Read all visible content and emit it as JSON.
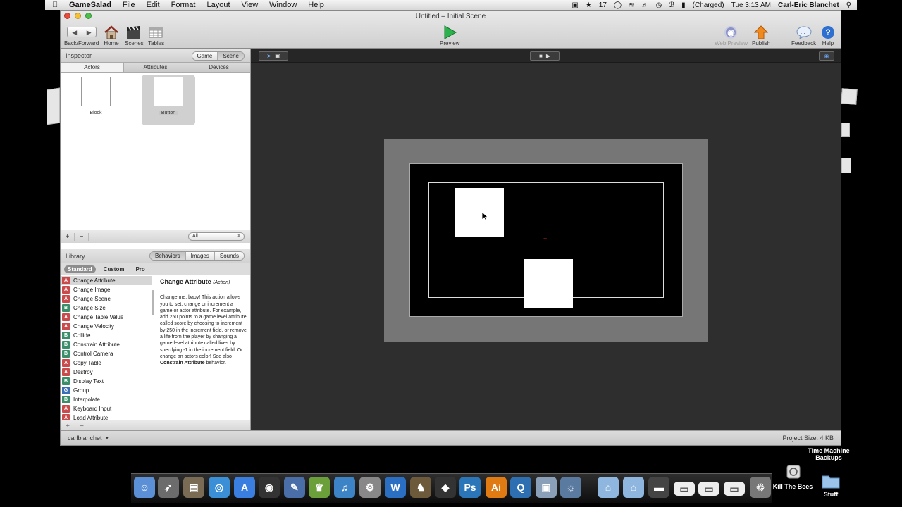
{
  "menubar": {
    "items": [
      "GameSalad",
      "File",
      "Edit",
      "Format",
      "Layout",
      "View",
      "Window",
      "Help"
    ],
    "status_badge": "17",
    "battery": "(Charged)",
    "clock": "Tue 3:13 AM",
    "user": "Carl-Eric Blanchet"
  },
  "window": {
    "title": "Untitled – Initial Scene",
    "toolbar": {
      "backforward": "Back/Forward",
      "home": "Home",
      "scenes": "Scenes",
      "tables": "Tables",
      "preview": "Preview",
      "web_preview": "Web Preview",
      "publish": "Publish",
      "feedback": "Feedback",
      "help": "Help"
    }
  },
  "inspector": {
    "title": "Inspector",
    "seg_game": "Game",
    "seg_scene": "Scene",
    "tabs": [
      "Actors",
      "Attributes",
      "Devices"
    ],
    "actors": [
      {
        "name": "Block"
      },
      {
        "name": "Button"
      }
    ],
    "plus": "+",
    "minus": "−",
    "filter": "All"
  },
  "library": {
    "title": "Library",
    "tabs": [
      "Behaviors",
      "Images",
      "Sounds"
    ],
    "subtabs": [
      "Standard",
      "Custom",
      "Pro"
    ],
    "behaviors": [
      {
        "badge": "A",
        "label": "Change Attribute"
      },
      {
        "badge": "A",
        "label": "Change Image"
      },
      {
        "badge": "A",
        "label": "Change Scene"
      },
      {
        "badge": "B",
        "label": "Change Size"
      },
      {
        "badge": "A",
        "label": "Change Table Value"
      },
      {
        "badge": "A",
        "label": "Change Velocity"
      },
      {
        "badge": "B",
        "label": "Collide"
      },
      {
        "badge": "B",
        "label": "Constrain Attribute"
      },
      {
        "badge": "B",
        "label": "Control Camera"
      },
      {
        "badge": "A",
        "label": "Copy Table"
      },
      {
        "badge": "A",
        "label": "Destroy"
      },
      {
        "badge": "B",
        "label": "Display Text"
      },
      {
        "badge": "G",
        "label": "Group"
      },
      {
        "badge": "B",
        "label": "Interpolate"
      },
      {
        "badge": "A",
        "label": "Keyboard Input"
      },
      {
        "badge": "A",
        "label": "Load Attribute"
      }
    ],
    "description": {
      "title": "Change Attribute",
      "kind": "(Action)",
      "body": "Change me, baby! This action allows you to set, change or increment a game or actor attribute. For example, add 250 points to a game level attribute called score by choosing to increment by 250 in the increment field, or remove a life from the player by changing a game level attribute called lives by specifying -1 in the increment field. Or change an actors color! See also ",
      "link": "Constrain Attribute",
      "tail": " behavior."
    },
    "plus": "+",
    "minus": "−"
  },
  "status": {
    "user": "carlblanchet",
    "project_size": "Project Size: 4 KB"
  },
  "desktop": {
    "time_machine": "Time Machine Backups",
    "kill_the_bees": "Kill The Bees",
    "stuff": "Stuff"
  },
  "dock_icons": [
    "finder-icon",
    "rocket-icon",
    "system-icon",
    "safari-icon",
    "appstore-icon",
    "dashboard-icon",
    "xcode-icon",
    "game-icon",
    "itunes-icon",
    "preferences-icon",
    "word-icon",
    "gimp-icon",
    "inkscape-icon",
    "photoshop-icon",
    "illustrator-icon",
    "quicktime-icon",
    "preview-icon",
    "iphoto-icon",
    "applications-folder-icon",
    "documents-folder-icon",
    "hd-icon",
    "window1-icon",
    "window2-icon",
    "window3-icon",
    "trash-icon"
  ],
  "colors": {
    "photoshop": "#2a76b8",
    "illustrator": "#e07a12",
    "preview_play": "#2bb24c",
    "publish": "#f08a1f",
    "help": "#2f6fd0"
  }
}
